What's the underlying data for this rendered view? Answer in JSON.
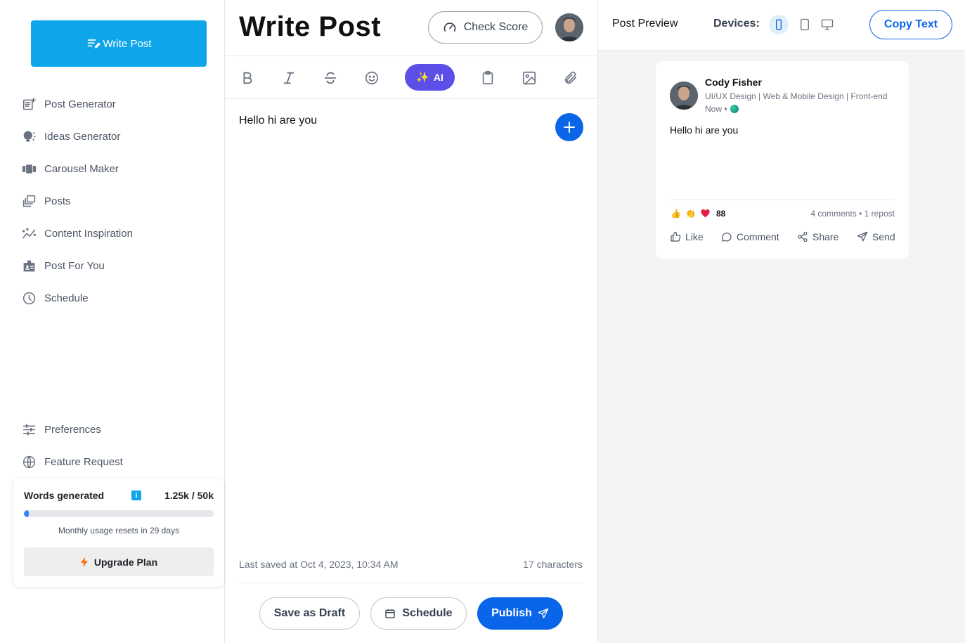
{
  "sidebar": {
    "write_button": "Write Post",
    "nav": [
      {
        "label": "Post Generator",
        "icon": "post-generator-icon"
      },
      {
        "label": "Ideas Generator",
        "icon": "lightbulb-icon"
      },
      {
        "label": "Carousel Maker",
        "icon": "carousel-icon"
      },
      {
        "label": "Posts",
        "icon": "posts-icon"
      },
      {
        "label": "Content Inspiration",
        "icon": "trend-icon"
      },
      {
        "label": "Post For You",
        "icon": "id-card-icon"
      },
      {
        "label": "Schedule",
        "icon": "clock-icon"
      }
    ],
    "bottom_nav": [
      {
        "label": "Preferences",
        "icon": "sliders-icon"
      },
      {
        "label": "Feature Request",
        "icon": "globe-icon"
      }
    ],
    "usage": {
      "title": "Words generated",
      "count": "1.25k / 50k",
      "progress_fraction": 0.025,
      "reset_text": "Monthly usage resets in 29 days",
      "upgrade_label": "Upgrade Plan"
    }
  },
  "editor": {
    "title": "Write Post",
    "check_score_label": "Check Score",
    "ai_label": "AI",
    "content": "Hello hi are you",
    "last_saved": "Last saved at Oct 4, 2023, 10:34 AM",
    "char_count": "17 characters",
    "save_draft_label": "Save as Draft",
    "schedule_label": "Schedule",
    "publish_label": "Publish"
  },
  "preview": {
    "title": "Post Preview",
    "devices_label": "Devices:",
    "active_device": "mobile",
    "copy_label": "Copy Text",
    "post": {
      "author_name": "Cody Fisher",
      "author_headline": "UI/UX Design | Web & Mobile Design | Front-end",
      "time": "Now •",
      "body": "Hello hi are you",
      "reaction_count": "88",
      "stats": "4 comments • 1 repost",
      "actions": {
        "like": "Like",
        "comment": "Comment",
        "share": "Share",
        "send": "Send"
      }
    }
  },
  "colors": {
    "write_button": "#0ea5e9",
    "ai_button": "#5b4fe8",
    "primary": "#0a66e8",
    "progress": "#3b82f6"
  }
}
